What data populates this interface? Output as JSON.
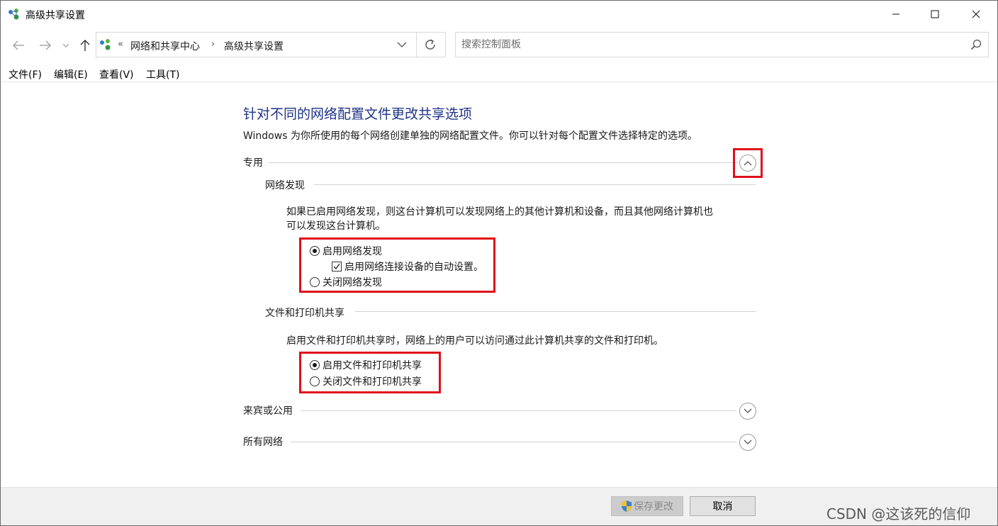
{
  "window": {
    "title": "高级共享设置",
    "controls": {
      "minimize": "—",
      "maximize": "☐",
      "close": "✕"
    }
  },
  "address": {
    "prefix": "«",
    "breadcrumbs": [
      "网络和共享中心",
      "高级共享设置"
    ],
    "separator": "›"
  },
  "search": {
    "placeholder": "搜索控制面板",
    "value": ""
  },
  "menu": [
    "文件(F)",
    "编辑(E)",
    "查看(V)",
    "工具(T)"
  ],
  "content": {
    "title": "针对不同的网络配置文件更改共享选项",
    "description": "Windows 为你所使用的每个网络创建单独的网络配置文件。你可以针对每个配置文件选择特定的选项。",
    "profiles": {
      "private": {
        "label": "专用",
        "expanded": true
      },
      "guest": {
        "label": "来宾或公用",
        "expanded": false
      },
      "all": {
        "label": "所有网络",
        "expanded": false
      }
    },
    "network_discovery": {
      "label": "网络发现",
      "text_line1": "如果已启用网络发现，则这台计算机可以发现网络上的其他计算机和设备，而且其他网络计算机也",
      "text_line2": "可以发现这台计算机。",
      "enable": "启用网络发现",
      "auto_setup": "启用网络连接设备的自动设置。",
      "disable": "关闭网络发现",
      "selected": "enable",
      "auto_setup_checked": true
    },
    "file_printer_sharing": {
      "label": "文件和打印机共享",
      "text": "启用文件和打印机共享时，网络上的用户可以访问通过此计算机共享的文件和打印机。",
      "enable": "启用文件和打印机共享",
      "disable": "关闭文件和打印机共享",
      "selected": "enable"
    }
  },
  "buttons": {
    "save": "保存更改",
    "cancel": "取消"
  },
  "watermark": "CSDN @这该死的信仰",
  "colors": {
    "title_blue": "#1e3287",
    "highlight_red": "#e0101b"
  }
}
